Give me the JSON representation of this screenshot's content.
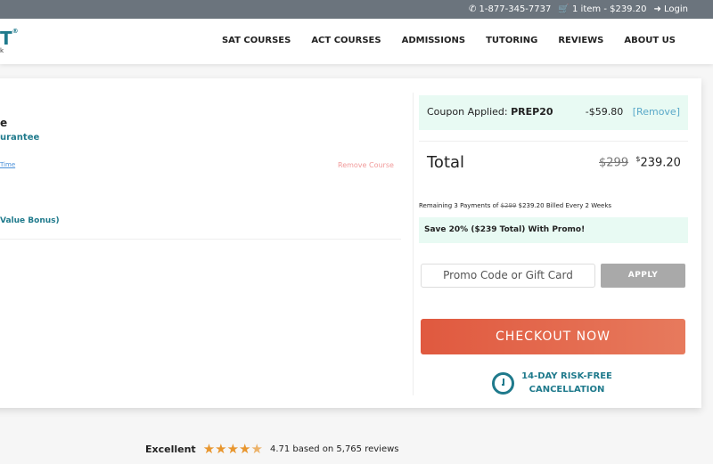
{
  "topbar": {
    "phone": "1-877-345-7737",
    "cart": "1 item - $239.20",
    "login": "Login"
  },
  "logo": {
    "text": "T",
    "mark": "®",
    "sub": "k"
  },
  "nav": [
    "SAT COURSES",
    "ACT COURSES",
    "ADMISSIONS",
    "TUTORING",
    "REVIEWS",
    "ABOUT US"
  ],
  "course": {
    "title_fragment": "e",
    "guarantee_fragment": "urantee",
    "link_fragment": "Time",
    "remove": "Remove Course",
    "bonus_fragment": "Value Bonus)"
  },
  "summary": {
    "coupon_label": "Coupon Applied:",
    "coupon_code": "PREP20",
    "discount": "-$59.80",
    "remove": "[Remove]",
    "total_label": "Total",
    "original": "$299",
    "price_sup": "$",
    "price": "239.20",
    "remaining_prefix": "Remaining 3 Payments of",
    "remaining_original": "$299",
    "remaining_price": "$239.20",
    "remaining_suffix": "Billed Every 2 Weeks",
    "save_promo": "Save 20% ($239 Total) With Promo!",
    "promo_placeholder": "Promo Code or Gift Card",
    "apply": "APPLY",
    "checkout": "CHECKOUT NOW",
    "cancel_line1": "14-DAY RISK-FREE",
    "cancel_line2": "CANCELLATION"
  },
  "reviews": {
    "label": "Excellent",
    "rating": 4.71,
    "text": "4.71 based on 5,765 reviews"
  },
  "colors": {
    "teal": "#1f7a8c",
    "checkout": "#e0593f",
    "mint": "#e8faf3",
    "star": "#e8962e"
  }
}
